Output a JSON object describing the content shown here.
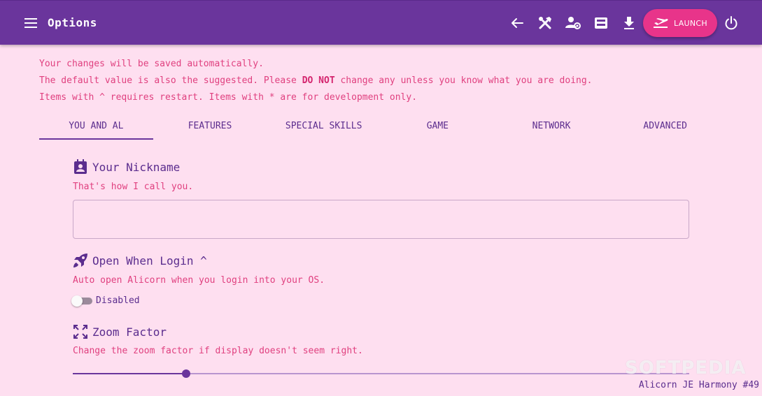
{
  "appbar": {
    "title": "Options",
    "icons": {
      "menu": "menu-icon",
      "back": "arrow-back-icon",
      "tools": "tools-icon",
      "account": "account-settings-icon",
      "inbox": "inbox-icon",
      "download": "download-icon",
      "power": "power-icon"
    },
    "launch_label": "LAUNCH"
  },
  "notices": {
    "line1": "Your changes will be saved automatically.",
    "line2_pre": "The default value is also the suggested. Please ",
    "line2_bold": "DO NOT",
    "line2_post": " change any unless you know what you are doing.",
    "line3": "Items with ^ requires restart. Items with * are for development only."
  },
  "tabs": [
    {
      "label": "YOU AND AL",
      "active": true
    },
    {
      "label": "FEATURES",
      "active": false
    },
    {
      "label": "SPECIAL SKILLS",
      "active": false
    },
    {
      "label": "GAME",
      "active": false
    },
    {
      "label": "NETWORK",
      "active": false
    },
    {
      "label": "ADVANCED",
      "active": false
    }
  ],
  "settings": {
    "nickname": {
      "title": "Your Nickname",
      "description": "That's how I call you.",
      "value": "",
      "icon": "contact-badge-icon"
    },
    "open_when_login": {
      "title": "Open When Login ^",
      "description": "Auto open Alicorn when you login into your OS.",
      "state_label": "Disabled",
      "enabled": false,
      "icon": "rocket-icon"
    },
    "zoom_factor": {
      "title": "Zoom Factor",
      "description": "Change the zoom factor if display doesn't seem right.",
      "slider_fraction": 0.184,
      "icon": "fullscreen-icon"
    }
  },
  "footer": {
    "version": "Alicorn JE Harmony #49"
  },
  "watermark": "SOFTPEDIA",
  "colors": {
    "appbar": "#6a359c",
    "background": "#fedff0",
    "accent": "#e8348a",
    "text_primary": "#5b2d8e",
    "text_secondary": "#e0407f"
  }
}
